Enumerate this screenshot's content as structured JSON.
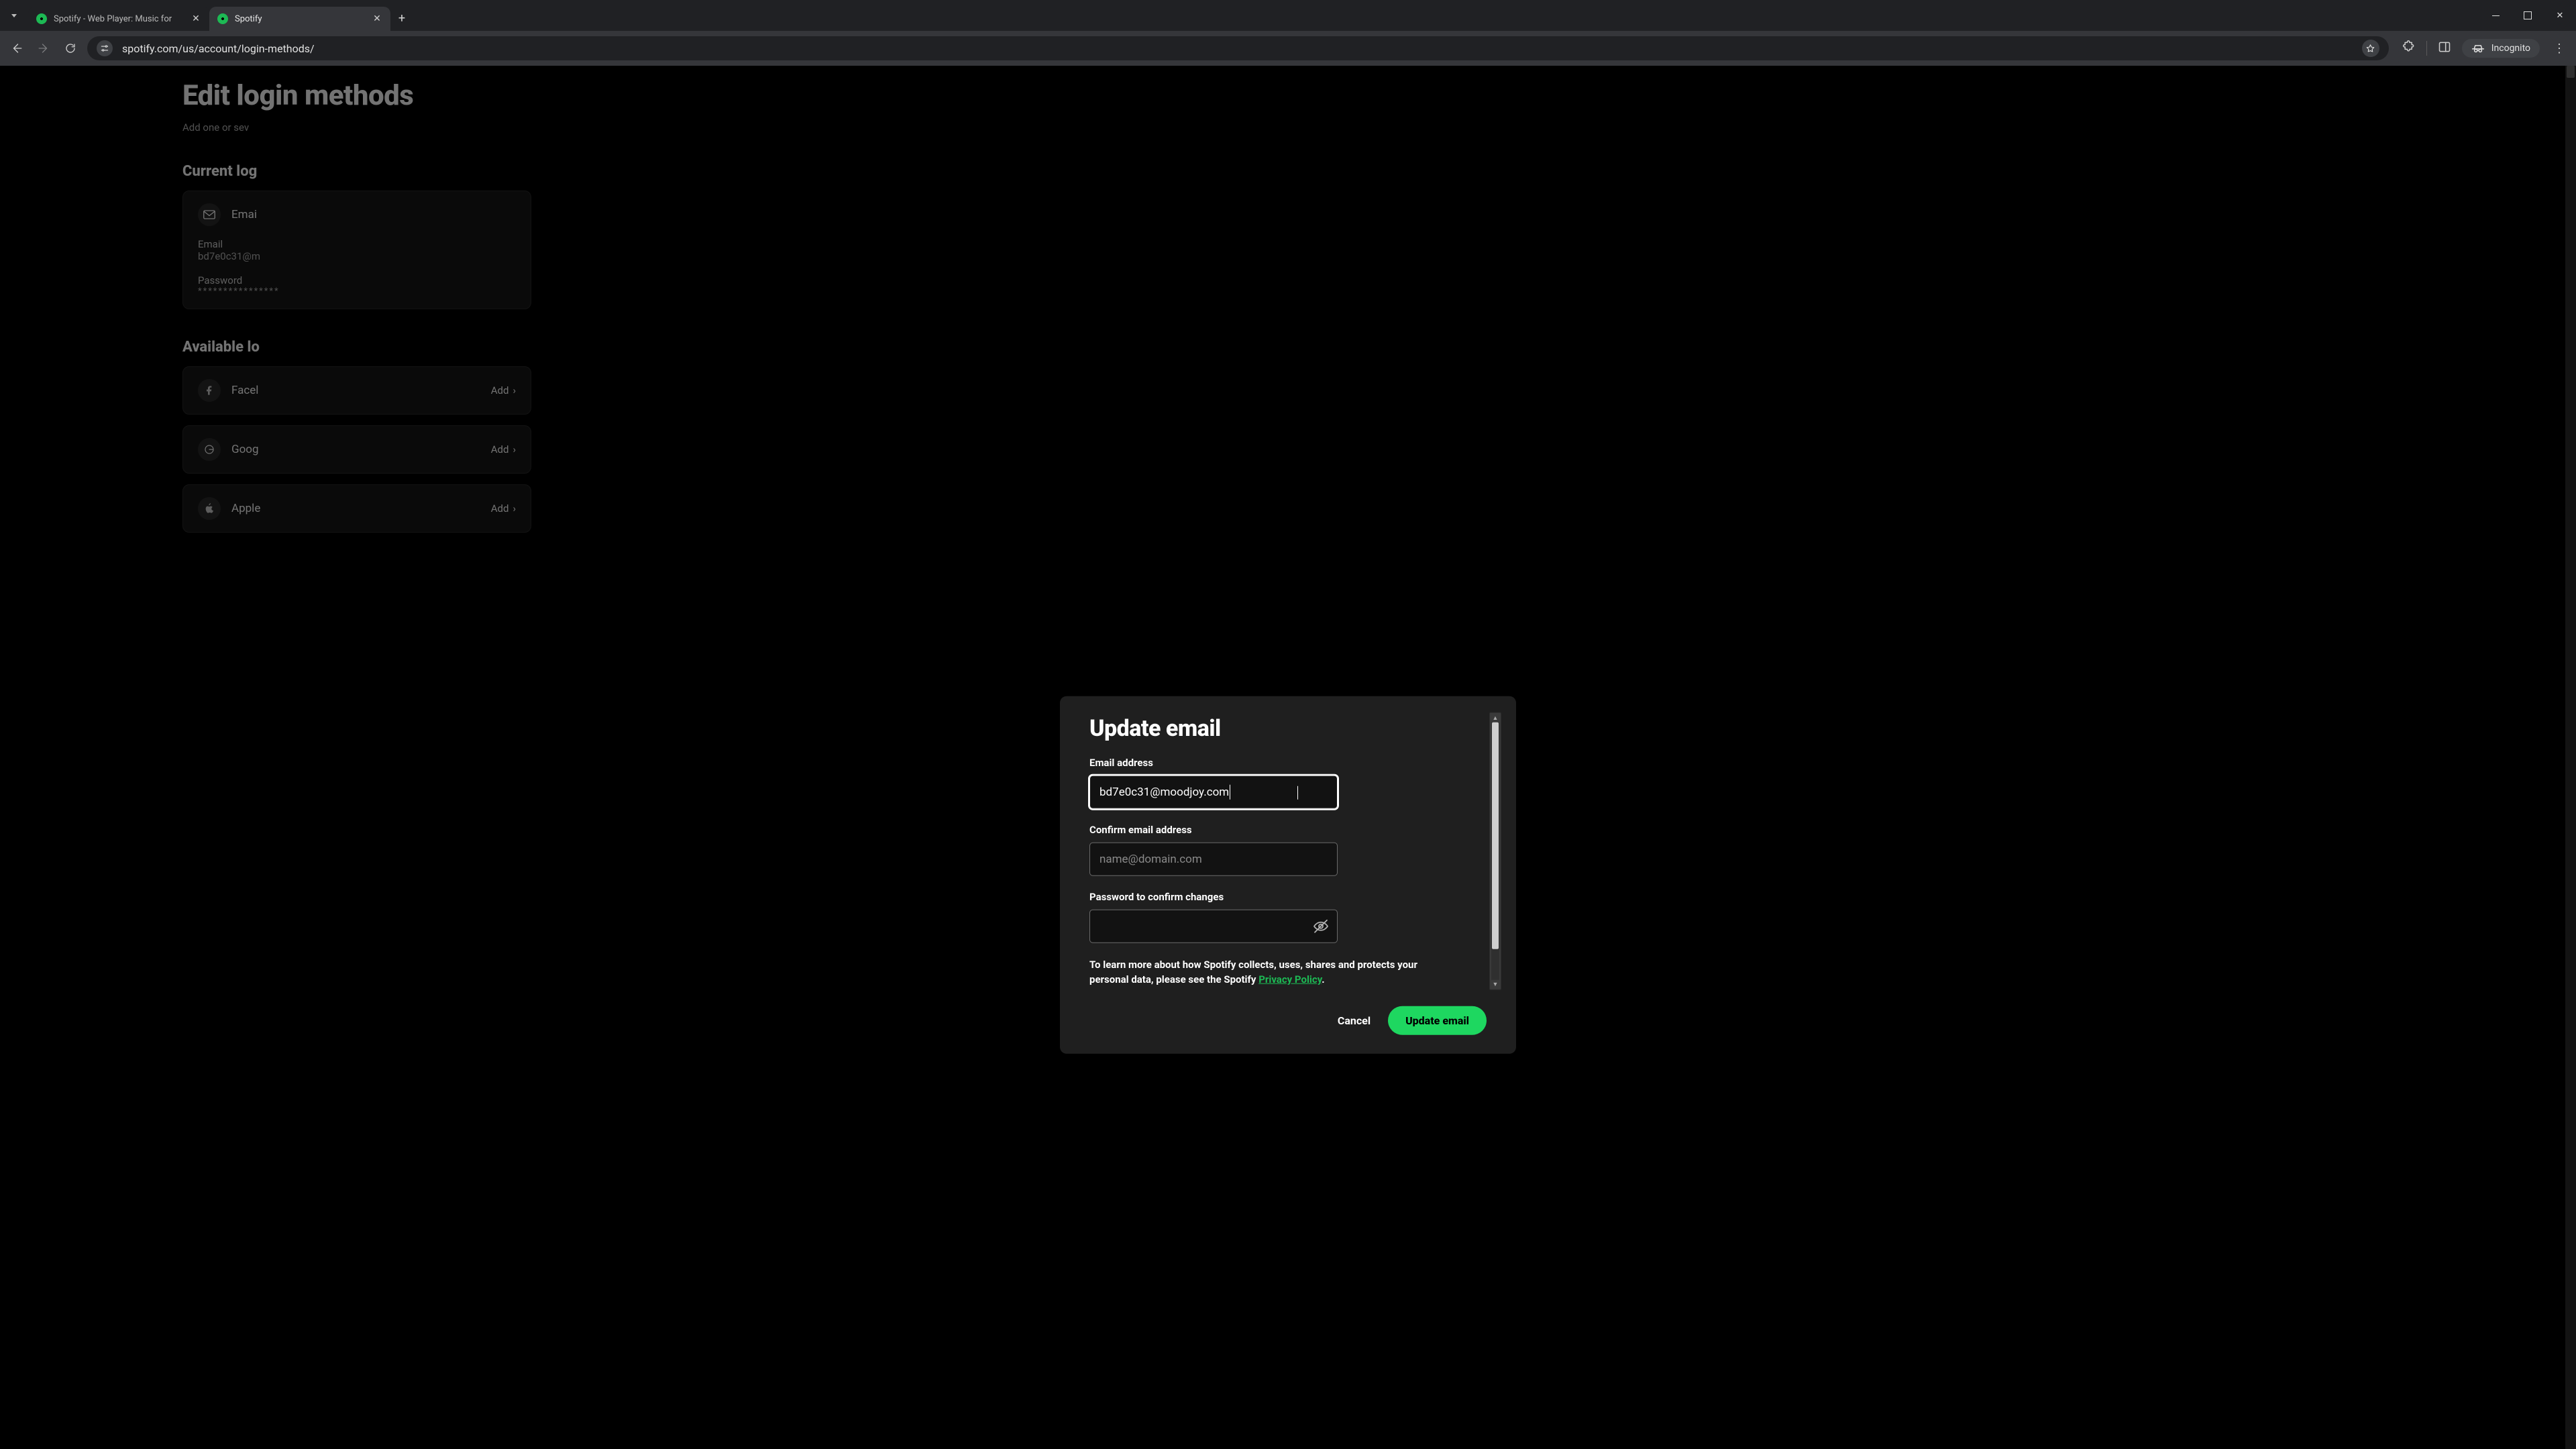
{
  "browser": {
    "tabs": [
      {
        "title": "Spotify - Web Player: Music for"
      },
      {
        "title": "Spotify"
      }
    ],
    "active_tab_index": 1,
    "url": "spotify.com/us/account/login-methods/",
    "incognito_label": "Incognito"
  },
  "page": {
    "title": "Edit login methods",
    "subtitle": "Add one or sev",
    "section_current": "Current log",
    "current": {
      "email_label": "Emai",
      "email_field_label": "Email",
      "email_value_truncated": "bd7e0c31@m",
      "password_label": "Password",
      "password_masked": "****************"
    },
    "section_available": "Available lo",
    "available": [
      {
        "name": "Facel"
      },
      {
        "name": "Goog"
      },
      {
        "name": "Apple"
      }
    ],
    "add_label": "Add"
  },
  "modal": {
    "title": "Update email",
    "email_label": "Email address",
    "email_value": "bd7e0c31@moodjoy.com",
    "confirm_label": "Confirm email address",
    "confirm_placeholder": "name@domain.com",
    "password_label": "Password to confirm changes",
    "policy_pre": "To learn more about how Spotify collects, uses, shares and protects your personal data, please see the Spotify ",
    "policy_link": "Privacy Policy",
    "policy_post": ".",
    "cancel": "Cancel",
    "submit": "Update email"
  }
}
